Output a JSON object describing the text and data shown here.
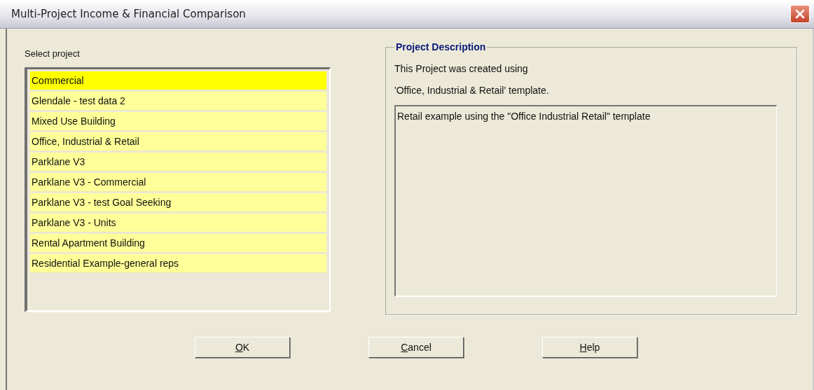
{
  "window": {
    "title": "Multi-Project Income & Financial Comparison"
  },
  "project_list": {
    "label": "Select project",
    "items": [
      {
        "label": "Commercial",
        "selected": true
      },
      {
        "label": "Glendale - test data 2",
        "selected": false
      },
      {
        "label": "Mixed Use Building",
        "selected": false
      },
      {
        "label": "Office, Industrial & Retail",
        "selected": false
      },
      {
        "label": "Parklane V3",
        "selected": false
      },
      {
        "label": "Parklane V3 - Commercial",
        "selected": false
      },
      {
        "label": "Parklane V3 - test Goal Seeking",
        "selected": false
      },
      {
        "label": "Parklane V3 - Units",
        "selected": false
      },
      {
        "label": "Rental Apartment Building",
        "selected": false
      },
      {
        "label": "Residential Example-general reps",
        "selected": false
      }
    ]
  },
  "description": {
    "title": "Project Description",
    "lines": [
      "This Project was created using",
      "'Office, Industrial & Retail' template."
    ],
    "text": "Retail example using the \"Office Industrial Retail\" template"
  },
  "buttons": [
    {
      "label": "OK",
      "access_key_underlined": true
    },
    {
      "label": "Cancel",
      "access_key_underlined": true
    },
    {
      "label": "Help",
      "access_key_underlined": true
    }
  ]
}
